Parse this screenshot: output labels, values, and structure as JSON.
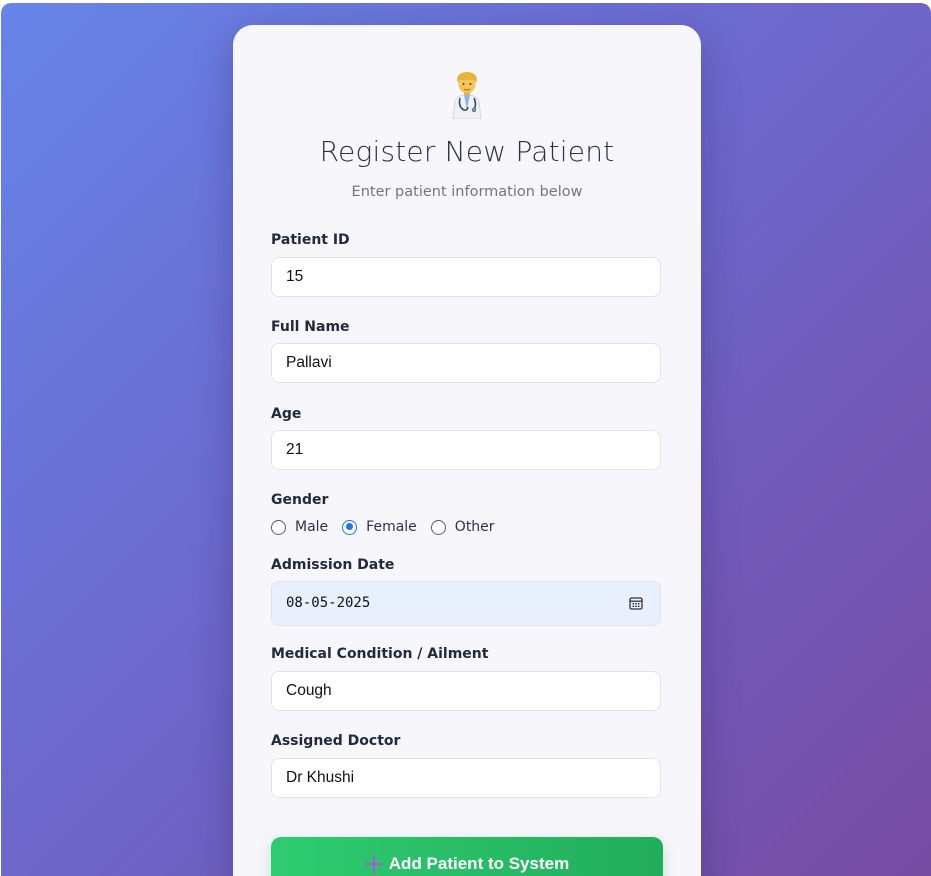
{
  "header": {
    "icon": "doctor-emoji-icon",
    "title": "Register New Patient",
    "subtitle": "Enter patient information below"
  },
  "form": {
    "patient_id": {
      "label": "Patient ID",
      "value": "15"
    },
    "full_name": {
      "label": "Full Name",
      "value": "Pallavi"
    },
    "age": {
      "label": "Age",
      "value": "21"
    },
    "gender": {
      "label": "Gender",
      "options": [
        "Male",
        "Female",
        "Other"
      ],
      "selected": "Female"
    },
    "admission_date": {
      "label": "Admission Date",
      "value": "08-05-2025"
    },
    "condition": {
      "label": "Medical Condition / Ailment",
      "value": "Cough"
    },
    "doctor": {
      "label": "Assigned Doctor",
      "value": "Dr Khushi"
    },
    "submit_label": "Add Patient to System"
  },
  "colors": {
    "background_start": "#667eea",
    "background_end": "#764ba2",
    "card": "#f6f6fb",
    "button_start": "#2ecc71",
    "button_end": "#22ad5c",
    "radio_accent": "#1f73e8"
  }
}
